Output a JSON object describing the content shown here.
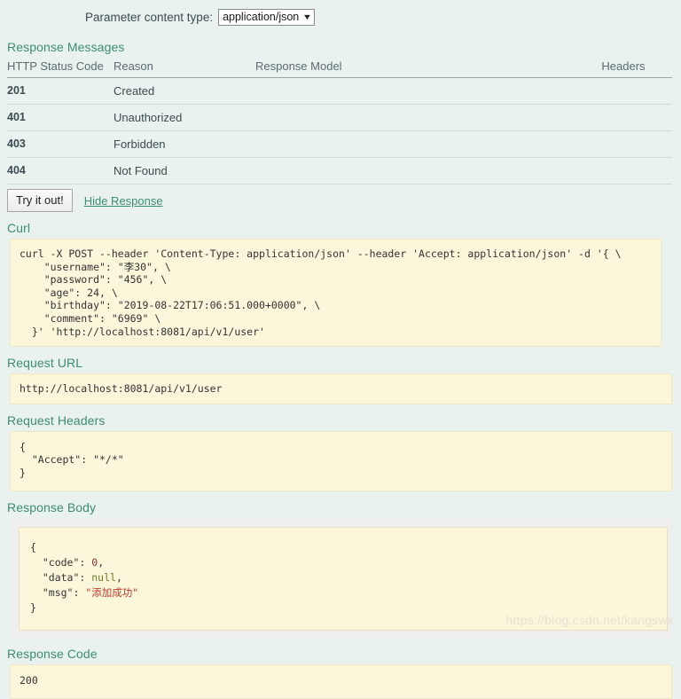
{
  "param_content_type": {
    "label": "Parameter content type:",
    "selected": "application/json",
    "caret_icon": "chevron-down-icon"
  },
  "response_messages": {
    "title": "Response Messages",
    "columns": [
      "HTTP Status Code",
      "Reason",
      "Response Model",
      "Headers"
    ],
    "rows": [
      {
        "code": "201",
        "reason": "Created",
        "model": "",
        "headers": ""
      },
      {
        "code": "401",
        "reason": "Unauthorized",
        "model": "",
        "headers": ""
      },
      {
        "code": "403",
        "reason": "Forbidden",
        "model": "",
        "headers": ""
      },
      {
        "code": "404",
        "reason": "Not Found",
        "model": "",
        "headers": ""
      }
    ]
  },
  "actions": {
    "try_it_out": "Try it out!",
    "hide_response": "Hide Response"
  },
  "curl": {
    "title": "Curl",
    "content": "curl -X POST --header 'Content-Type: application/json' --header 'Accept: application/json' -d '{ \\\n    \"username\": \"李30\", \\\n    \"password\": \"456\", \\\n    \"age\": 24, \\\n    \"birthday\": \"2019-08-22T17:06:51.000+0000\", \\\n    \"comment\": \"6969\" \\\n  }' 'http://localhost:8081/api/v1/user'"
  },
  "request_url": {
    "title": "Request URL",
    "value": "http://localhost:8081/api/v1/user"
  },
  "request_headers": {
    "title": "Request Headers",
    "content": "{\n  \"Accept\": \"*/*\"\n}"
  },
  "response_body": {
    "title": "Response Body",
    "lines": {
      "open_brace": "{",
      "code_key": "  \"code\": ",
      "code_value": "0",
      "code_comma": ",",
      "data_key": "  \"data\": ",
      "data_value": "null",
      "data_comma": ",",
      "msg_key": "  \"msg\": ",
      "msg_value": "\"添加成功\"",
      "close_brace": "}"
    }
  },
  "response_code": {
    "title": "Response Code",
    "value": "200"
  },
  "watermark": "https://blog.csdn.net/kangswx",
  "colors": {
    "page_background": "#eaf2ef",
    "heading_green": "#3b8d6e",
    "code_background": "#fcf6db",
    "response_body_wrapper": "#efefef",
    "json_number": "#8b2f2f",
    "json_null": "#6a7d27",
    "json_string": "#c0392b"
  }
}
